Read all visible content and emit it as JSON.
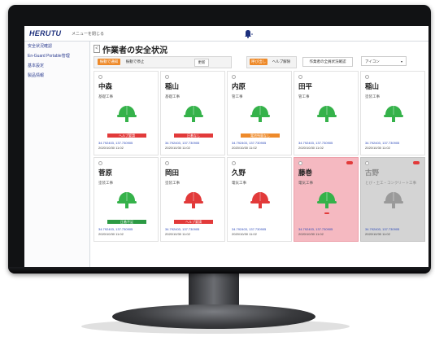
{
  "app": {
    "logo": "HERUTU",
    "menu_back": "メニューを閉じる",
    "bell_icon": "bell-icon"
  },
  "sidebar": {
    "items": [
      {
        "label": "安全状況確認"
      },
      {
        "label": "En-Guard Portable管理"
      },
      {
        "label": "基本設定"
      },
      {
        "label": "製品情報"
      }
    ]
  },
  "page": {
    "title": "作業者の安全状況",
    "back": "<"
  },
  "toolbar": {
    "btn_vibrate": "振動で通知",
    "btn_stop": "振動で停止",
    "btn_refresh": "更新",
    "btn_call": "呼び出し",
    "btn_help": "ヘルプ解除",
    "btn_all_workers": "作業者の全員状況確認",
    "view_select": "アイコン",
    "chevron": "▾"
  },
  "colors": {
    "green": "#35b24a",
    "red": "#e23a3a",
    "gray": "#9a9a9a",
    "orange": "#ee8a2a",
    "badge_red": "#e23a3a",
    "badge_orange": "#ee8a2a",
    "badge_green": "#2c9a44"
  },
  "workers": [
    {
      "name": "中森",
      "role": "基礎工事",
      "helmet": "green",
      "state": "normal",
      "badge": "ヘルプ要請",
      "badge_color": "red",
      "coords": "34.792403, 137.730905",
      "time": "2020/10/30 11:02"
    },
    {
      "name": "稲山",
      "role": "基礎工事",
      "helmet": "green",
      "state": "normal",
      "badge": "圧着なし",
      "badge_color": "red",
      "coords": "34.792403, 137.730905",
      "time": "2020/10/30 11:02"
    },
    {
      "name": "内原",
      "role": "管工事",
      "helmet": "green",
      "state": "normal",
      "badge": "電池残量なし",
      "badge_color": "orange",
      "coords": "34.792403, 137.730905",
      "time": "2020/10/30 11:02"
    },
    {
      "name": "田平",
      "role": "管工事",
      "helmet": "green",
      "state": "normal",
      "badge": "",
      "badge_color": "",
      "coords": "34.792403, 137.730905",
      "time": "2020/10/30 11:02"
    },
    {
      "name": "稲山",
      "role": "塗装工事",
      "helmet": "green",
      "state": "normal",
      "badge": "",
      "badge_color": "",
      "coords": "34.792403, 137.730905",
      "time": "2020/10/30 11:02"
    },
    {
      "name": "菅原",
      "role": "塗装工事",
      "helmet": "green",
      "state": "normal",
      "badge": "圧着不足",
      "badge_color": "green",
      "coords": "34.792403, 137.730905",
      "time": "2020/10/30 11:02"
    },
    {
      "name": "岡田",
      "role": "塗装工事",
      "helmet": "red",
      "state": "normal",
      "badge": "ヘルプ要請",
      "badge_color": "red",
      "coords": "34.792403, 137.730905",
      "time": "2020/10/30 11:02"
    },
    {
      "name": "久野",
      "role": "電気工事",
      "helmet": "red",
      "state": "normal",
      "badge": "",
      "badge_color": "",
      "coords": "34.792403, 137.730905",
      "time": "2020/10/30 11:02"
    },
    {
      "name": "藤巻",
      "role": "電気工事",
      "helmet": "green",
      "state": "alert",
      "badge": "",
      "badge_color": "",
      "coords": "34.792403, 137.730905",
      "time": "2020/10/30 11:02"
    },
    {
      "name": "古野",
      "role": "とび・土工・コンクリート工事",
      "helmet": "gray",
      "state": "offline",
      "badge": "",
      "badge_color": "",
      "coords": "34.792403, 137.730905",
      "time": "2020/10/30 11:02"
    }
  ]
}
